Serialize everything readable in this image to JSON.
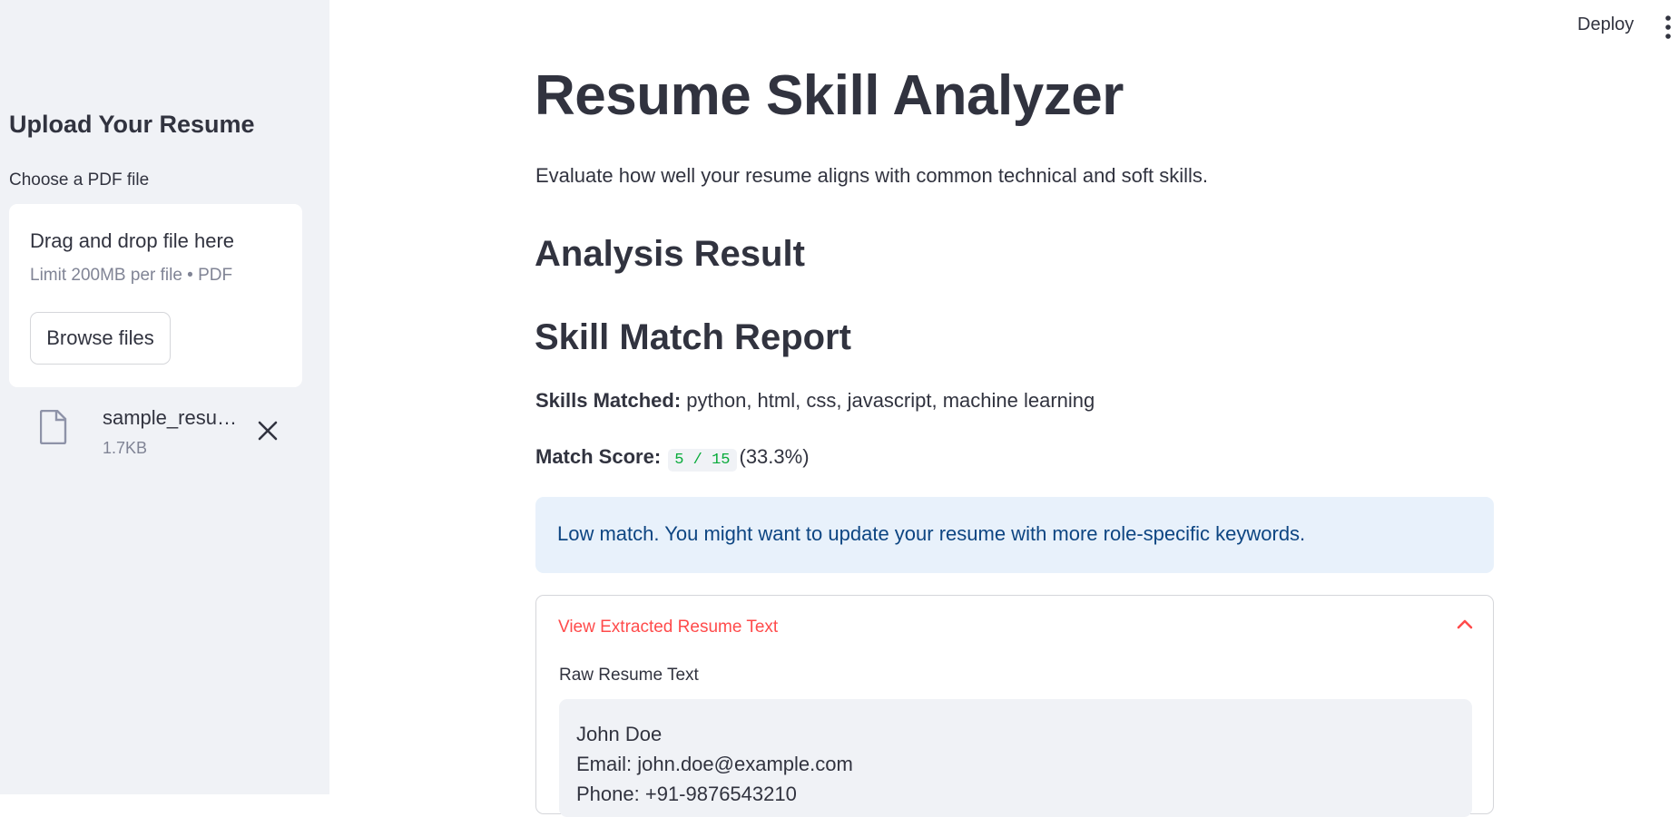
{
  "sidebar": {
    "title": "Upload Your Resume",
    "uploader_label": "Choose a PDF file",
    "dropzone": {
      "title": "Drag and drop file here",
      "limit": "Limit 200MB per file • PDF",
      "browse_label": "Browse files"
    },
    "file": {
      "name": "sample_resume.pdf",
      "size": "1.7KB"
    }
  },
  "topbar": {
    "deploy_label": "Deploy"
  },
  "main": {
    "title": "Resume Skill Analyzer",
    "subtitle": "Evaluate how well your resume aligns with common technical and soft skills.",
    "analysis_heading": "Analysis Result",
    "report_heading": "Skill Match Report",
    "skills_label": "Skills Matched:",
    "skills_value": "python, html, css, javascript, machine learning",
    "score_label": "Match Score:",
    "score_code": "5 / 15",
    "score_percent": "(33.3%)",
    "info_message": "Low match. You might want to update your resume with more role-specific keywords.",
    "expander": {
      "title": "View Extracted Resume Text",
      "raw_label": "Raw Resume Text",
      "lines": [
        "John Doe",
        "Email: john.doe@example.com",
        "Phone: +91-9876543210"
      ]
    }
  },
  "colors": {
    "sidebar_bg": "#f0f2f6",
    "text": "#31333f",
    "accent": "#ff4b4b",
    "info_bg": "#e8f1fb",
    "info_text": "#0d4582",
    "code_green": "#09ab3b"
  }
}
